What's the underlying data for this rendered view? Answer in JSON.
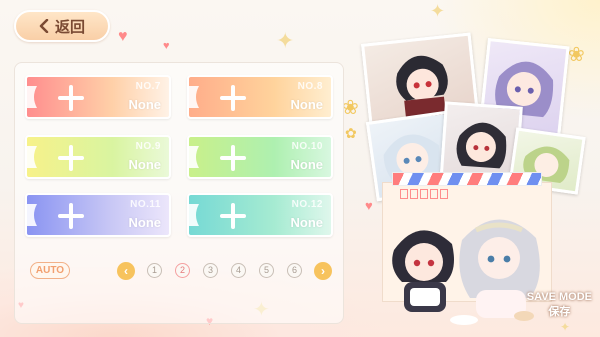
{
  "header": {
    "back_label": "返回"
  },
  "slots": [
    {
      "number": "NO.7",
      "name": "None",
      "gradient": "red"
    },
    {
      "number": "NO.8",
      "name": "None",
      "gradient": "orange"
    },
    {
      "number": "NO.9",
      "name": "None",
      "gradient": "yellow"
    },
    {
      "number": "NO.10",
      "name": "None",
      "gradient": "green"
    },
    {
      "number": "NO.11",
      "name": "None",
      "gradient": "blue"
    },
    {
      "number": "NO.12",
      "name": "None",
      "gradient": "teal"
    }
  ],
  "pagination": {
    "auto_label": "AUTO",
    "prev_icon": "chevron-left-icon",
    "next_icon": "chevron-right-icon",
    "pages": [
      "1",
      "2",
      "3",
      "4",
      "5",
      "6"
    ],
    "current_page": "2"
  },
  "mode": {
    "en": "SAVE MODE",
    "zh": "保存"
  },
  "colors": {
    "accent": "#f7c35d",
    "button": "#f9cfa7",
    "text_brown": "#7a4a33"
  }
}
